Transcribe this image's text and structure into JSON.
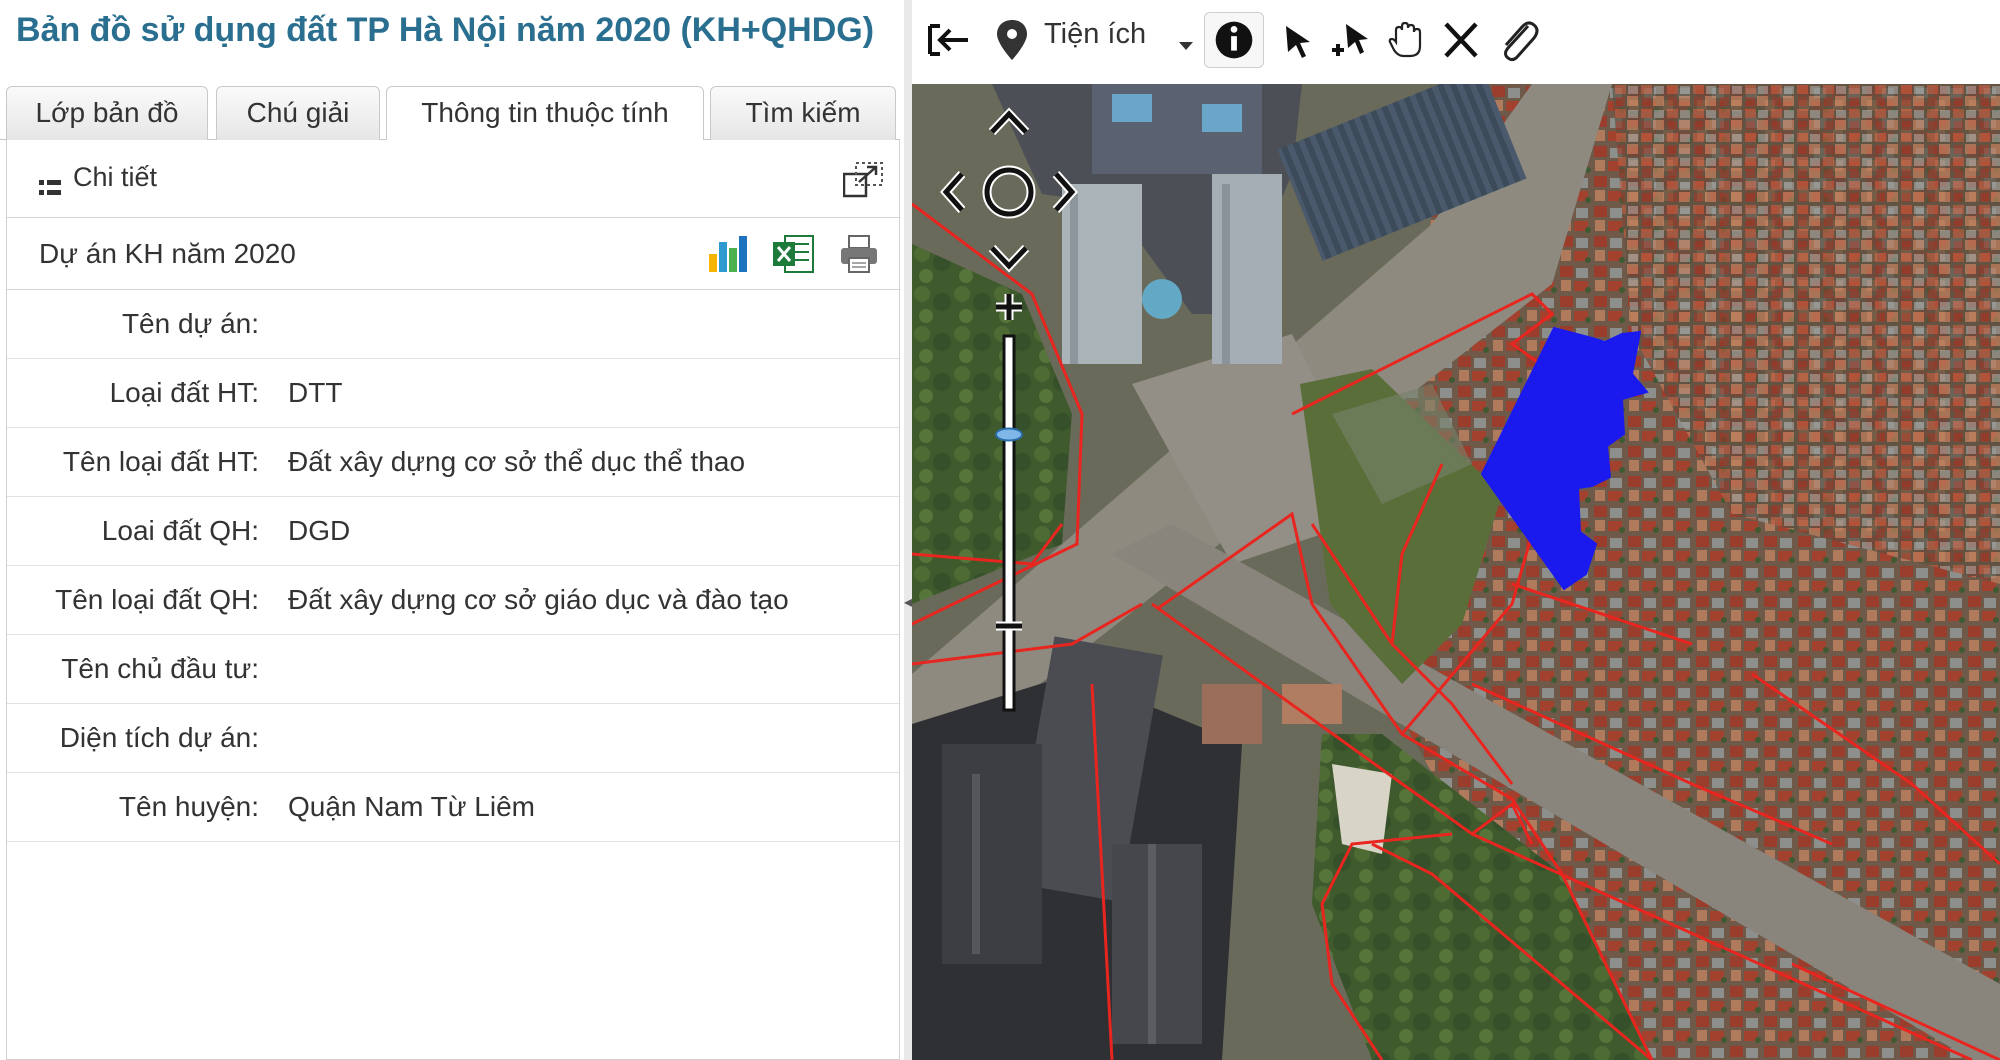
{
  "app": {
    "title": "Bản đồ sử dụng đất TP Hà Nội năm 2020 (KH+QHDG)"
  },
  "tabs": [
    {
      "label": "Lớp bản đồ",
      "active": false
    },
    {
      "label": "Chú giải",
      "active": false
    },
    {
      "label": "Thông tin thuộc tính",
      "active": true
    },
    {
      "label": "Tìm kiếm",
      "active": false
    }
  ],
  "detail": {
    "label": "Chi tiết"
  },
  "project": {
    "title": "Dự án KH năm 2020"
  },
  "attributes": [
    {
      "label": "Tên dự án:",
      "value": ""
    },
    {
      "label": "Loại đất HT:",
      "value": "DTT"
    },
    {
      "label": "Tên loại đất HT:",
      "value": "Đất xây dựng cơ sở thể dục thể thao"
    },
    {
      "label": "Loai đất QH:",
      "value": "DGD"
    },
    {
      "label": "Tên loại đất QH:",
      "value": "Đất xây dựng cơ sở giáo dục và đào tạo"
    },
    {
      "label": "Tên chủ đầu tư:",
      "value": ""
    },
    {
      "label": "Diện tích dự án:",
      "value": ""
    },
    {
      "label": "Tên huyện:",
      "value": "Quận Nam Từ Liêm"
    }
  ],
  "toolbar": {
    "utility_label": "Tiện ích",
    "icons": [
      "exit-icon",
      "map-pin-icon",
      "dropdown-icon",
      "info-icon",
      "select-icon",
      "select-add-icon",
      "pan-hand-icon",
      "clear-x-icon",
      "paperclip-icon"
    ]
  },
  "map": {
    "zoom_level": 0.25,
    "colors": {
      "parcel_outline": "#e8251f",
      "selected_parcel": "#1a1aef"
    }
  }
}
